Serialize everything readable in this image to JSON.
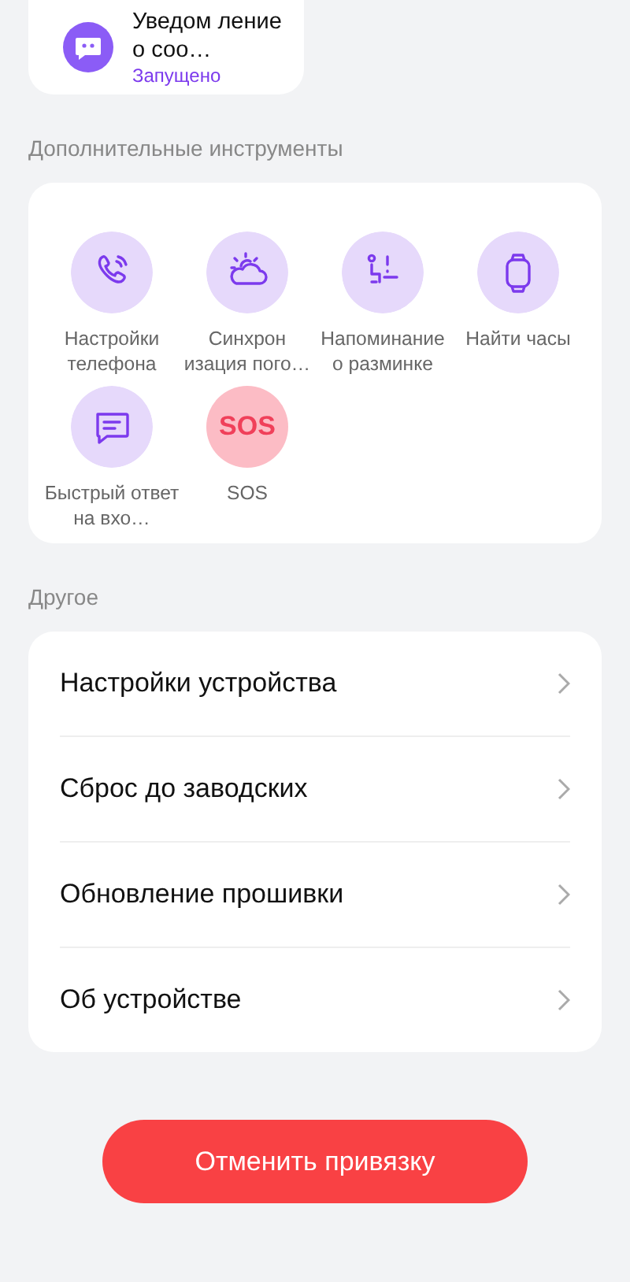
{
  "notification_card": {
    "title": "Уведом ление о соо…",
    "status": "Запущено"
  },
  "tools_section": {
    "title": "Дополнительные инструменты",
    "items": [
      {
        "kind": "phone",
        "label": "Настройки телефона"
      },
      {
        "kind": "weather",
        "label": "Синхрон изация пого…"
      },
      {
        "kind": "exercise",
        "label": "Напоминание о разминке"
      },
      {
        "kind": "watch",
        "label": "Найти часы"
      },
      {
        "kind": "message",
        "label": "Быстрый ответ на вхо…"
      },
      {
        "kind": "sos",
        "label": "SOS",
        "glyph": "SOS"
      }
    ]
  },
  "other_section": {
    "title": "Другое",
    "items": [
      "Настройки устройства",
      "Сброс до заводских",
      "Обновление прошивки",
      "Об устройстве"
    ]
  },
  "unbind_button": "Отменить привязку"
}
